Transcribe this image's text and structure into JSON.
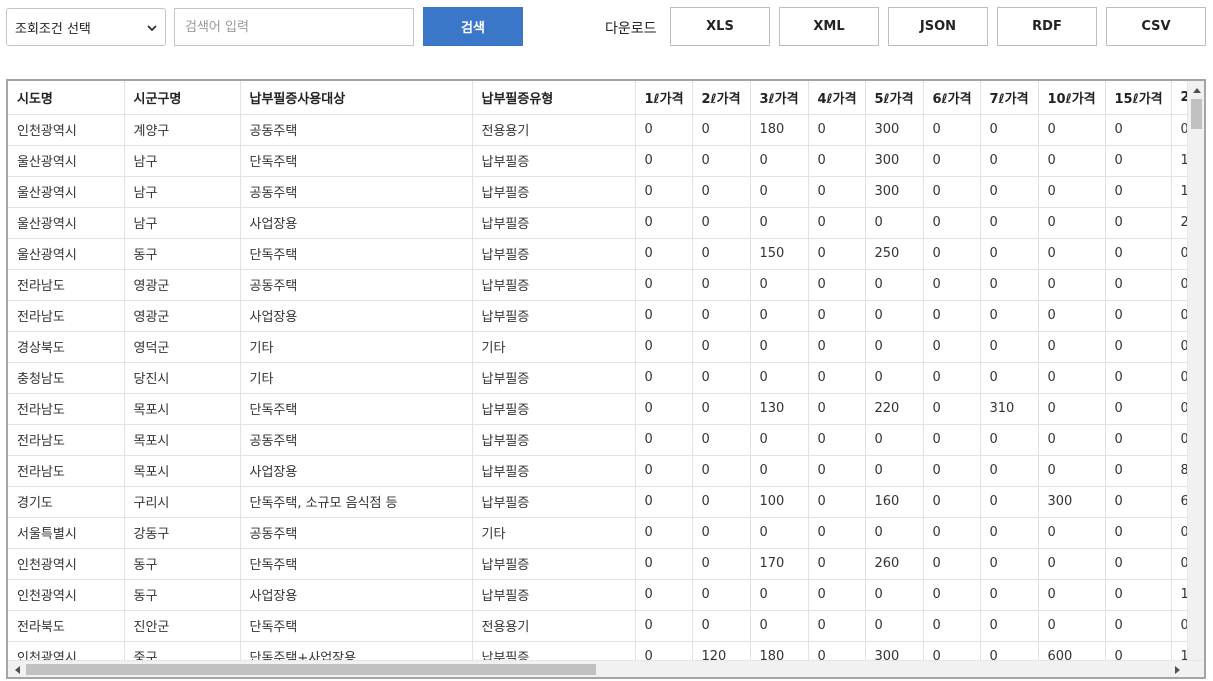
{
  "toolbar": {
    "select_value": "조회조건 선택",
    "search_placeholder": "검색어 입력",
    "search_label": "검색",
    "download_label": "다운로드",
    "downloads": [
      "XLS",
      "XML",
      "JSON",
      "RDF",
      "CSV"
    ],
    "accent_color": "#3a77c9"
  },
  "table": {
    "headers": [
      "시도명",
      "시군구명",
      "납부필증사용대상",
      "납부필증유형",
      "1ℓ가격",
      "2ℓ가격",
      "3ℓ가격",
      "4ℓ가격",
      "5ℓ가격",
      "6ℓ가격",
      "7ℓ가격",
      "10ℓ가격",
      "15ℓ가격",
      "2"
    ],
    "rows": [
      [
        "인천광역시",
        "계양구",
        "공동주택",
        "전용용기",
        "0",
        "0",
        "180",
        "0",
        "300",
        "0",
        "0",
        "0",
        "0",
        "0"
      ],
      [
        "울산광역시",
        "남구",
        "단독주택",
        "납부필증",
        "0",
        "0",
        "0",
        "0",
        "300",
        "0",
        "0",
        "0",
        "0",
        "1"
      ],
      [
        "울산광역시",
        "남구",
        "공동주택",
        "납부필증",
        "0",
        "0",
        "0",
        "0",
        "300",
        "0",
        "0",
        "0",
        "0",
        "1"
      ],
      [
        "울산광역시",
        "남구",
        "사업장용",
        "납부필증",
        "0",
        "0",
        "0",
        "0",
        "0",
        "0",
        "0",
        "0",
        "0",
        "2"
      ],
      [
        "울산광역시",
        "동구",
        "단독주택",
        "납부필증",
        "0",
        "0",
        "150",
        "0",
        "250",
        "0",
        "0",
        "0",
        "0",
        "0"
      ],
      [
        "전라남도",
        "영광군",
        "공동주택",
        "납부필증",
        "0",
        "0",
        "0",
        "0",
        "0",
        "0",
        "0",
        "0",
        "0",
        "0"
      ],
      [
        "전라남도",
        "영광군",
        "사업장용",
        "납부필증",
        "0",
        "0",
        "0",
        "0",
        "0",
        "0",
        "0",
        "0",
        "0",
        "0"
      ],
      [
        "경상북도",
        "영덕군",
        "기타",
        "기타",
        "0",
        "0",
        "0",
        "0",
        "0",
        "0",
        "0",
        "0",
        "0",
        "0"
      ],
      [
        "충청남도",
        "당진시",
        "기타",
        "납부필증",
        "0",
        "0",
        "0",
        "0",
        "0",
        "0",
        "0",
        "0",
        "0",
        "0"
      ],
      [
        "전라남도",
        "목포시",
        "단독주택",
        "납부필증",
        "0",
        "0",
        "130",
        "0",
        "220",
        "0",
        "310",
        "0",
        "0",
        "0"
      ],
      [
        "전라남도",
        "목포시",
        "공동주택",
        "납부필증",
        "0",
        "0",
        "0",
        "0",
        "0",
        "0",
        "0",
        "0",
        "0",
        "0"
      ],
      [
        "전라남도",
        "목포시",
        "사업장용",
        "납부필증",
        "0",
        "0",
        "0",
        "0",
        "0",
        "0",
        "0",
        "0",
        "0",
        "8"
      ],
      [
        "경기도",
        "구리시",
        "단독주택, 소규모 음식점 등",
        "납부필증",
        "0",
        "0",
        "100",
        "0",
        "160",
        "0",
        "0",
        "300",
        "0",
        "6"
      ],
      [
        "서울특별시",
        "강동구",
        "공동주택",
        "기타",
        "0",
        "0",
        "0",
        "0",
        "0",
        "0",
        "0",
        "0",
        "0",
        "0"
      ],
      [
        "인천광역시",
        "동구",
        "단독주택",
        "납부필증",
        "0",
        "0",
        "170",
        "0",
        "260",
        "0",
        "0",
        "0",
        "0",
        "0"
      ],
      [
        "인천광역시",
        "동구",
        "사업장용",
        "납부필증",
        "0",
        "0",
        "0",
        "0",
        "0",
        "0",
        "0",
        "0",
        "0",
        "1"
      ],
      [
        "전라북도",
        "진안군",
        "단독주택",
        "전용용기",
        "0",
        "0",
        "0",
        "0",
        "0",
        "0",
        "0",
        "0",
        "0",
        "0"
      ],
      [
        "인천광역시",
        "중구",
        "단독주택+사업장용",
        "납부필증",
        "0",
        "120",
        "180",
        "0",
        "300",
        "0",
        "0",
        "600",
        "0",
        "1"
      ]
    ]
  }
}
